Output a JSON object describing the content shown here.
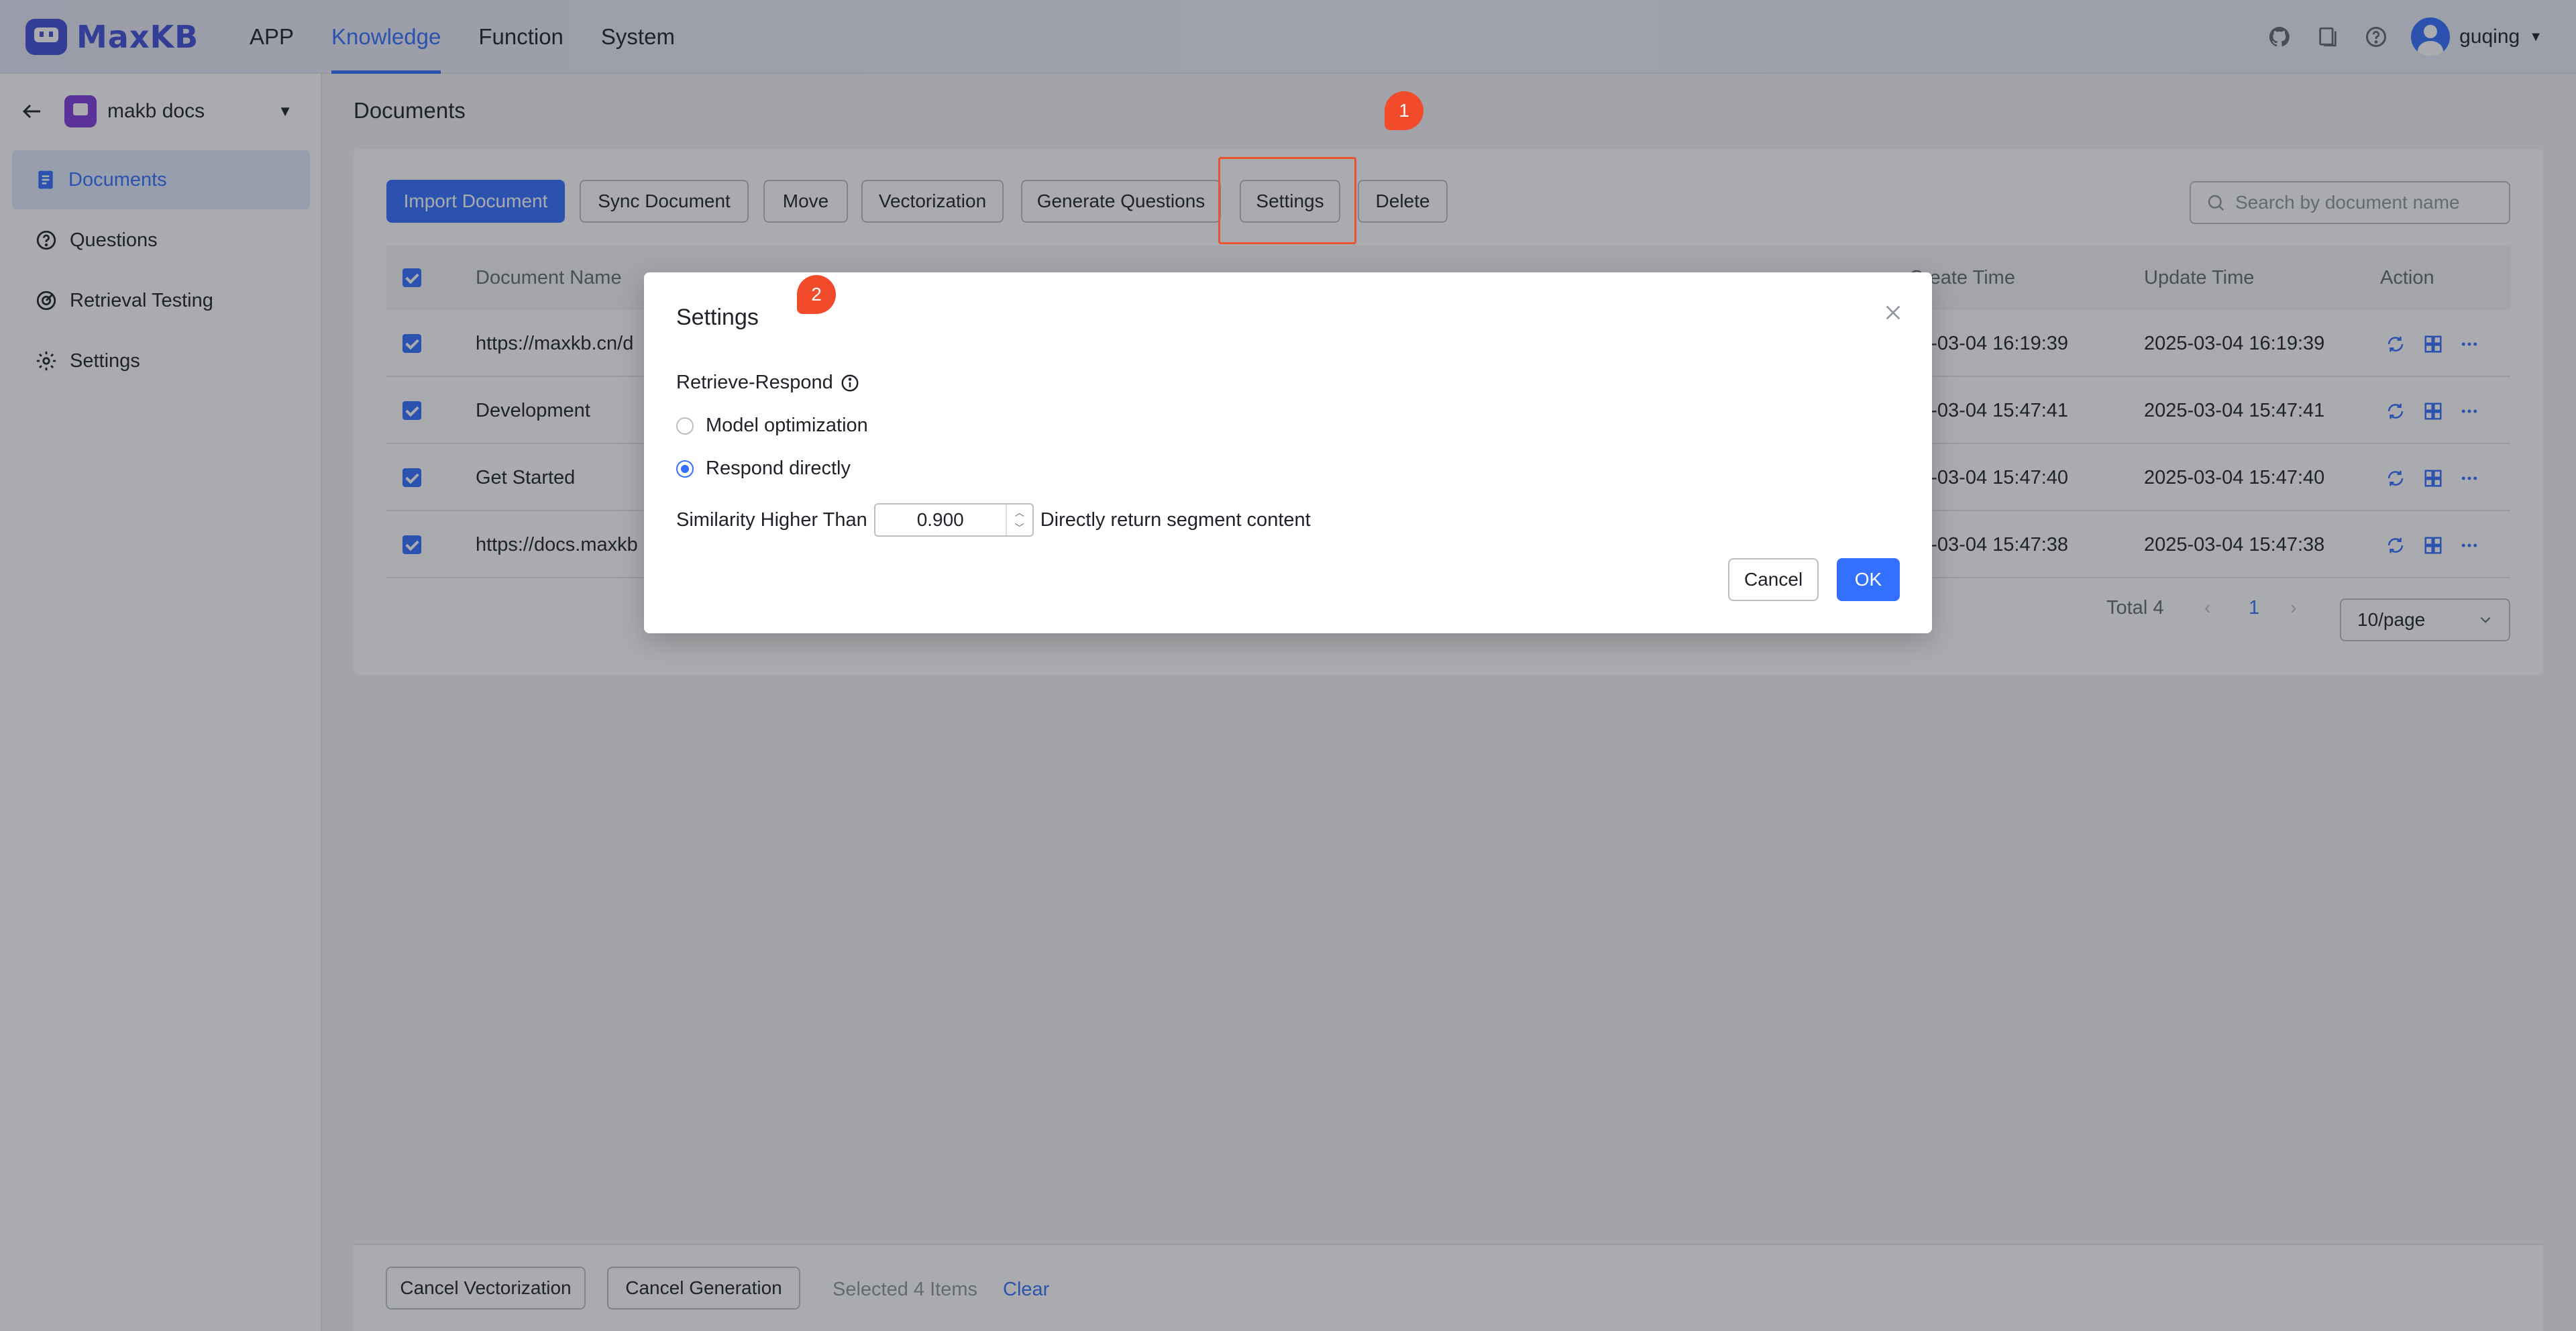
{
  "app": {
    "logo": "MaxKB"
  },
  "nav": [
    {
      "label": "APP",
      "active": false
    },
    {
      "label": "Knowledge",
      "active": true
    },
    {
      "label": "Function",
      "active": false
    },
    {
      "label": "System",
      "active": false
    }
  ],
  "user": {
    "name": "guqing"
  },
  "sidebar": {
    "knowledge_name": "makb docs",
    "items": [
      {
        "label": "Documents",
        "icon": "document-icon",
        "active": true
      },
      {
        "label": "Questions",
        "icon": "question-icon",
        "active": false
      },
      {
        "label": "Retrieval Testing",
        "icon": "target-icon",
        "active": false
      },
      {
        "label": "Settings",
        "icon": "gear-icon",
        "active": false
      }
    ]
  },
  "main": {
    "title": "Documents",
    "toolbar": {
      "import": "Import Document",
      "sync": "Sync Document",
      "move": "Move",
      "vectorization": "Vectorization",
      "generate": "Generate Questions",
      "settings": "Settings",
      "delete": "Delete"
    },
    "search_placeholder": "Search by document name",
    "columns": {
      "name": "Document Name",
      "create": "Create Time",
      "update": "Update Time",
      "action": "Action"
    },
    "rows": [
      {
        "name": "https://maxkb.cn/d",
        "create": "25-03-04 16:19:39",
        "update": "2025-03-04 16:19:39"
      },
      {
        "name": "Development",
        "create": "25-03-04 15:47:41",
        "update": "2025-03-04 15:47:41"
      },
      {
        "name": "Get Started",
        "create": "25-03-04 15:47:40",
        "update": "2025-03-04 15:47:40"
      },
      {
        "name": "https://docs.maxkb",
        "create": "25-03-04 15:47:38",
        "update": "2025-03-04 15:47:38"
      }
    ],
    "pagination": {
      "total": "Total 4",
      "page": "1",
      "page_size": "10/page"
    }
  },
  "footer": {
    "cancel_vectorization": "Cancel Vectorization",
    "cancel_generation": "Cancel Generation",
    "selected": "Selected 4 Items",
    "clear": "Clear"
  },
  "dialog": {
    "title": "Settings",
    "label": "Retrieve-Respond",
    "option_model": "Model optimization",
    "option_direct": "Respond directly",
    "selected_option": "Respond directly",
    "similarity_label": "Similarity Higher Than",
    "similarity_value": "0.900",
    "similarity_suffix": "Directly return segment content",
    "cancel": "Cancel",
    "ok": "OK"
  },
  "annotations": {
    "badge1": "1",
    "badge2": "2"
  },
  "colors": {
    "accent": "#3370ff",
    "badge": "#f24b2b",
    "logo": "#3f51d8"
  }
}
